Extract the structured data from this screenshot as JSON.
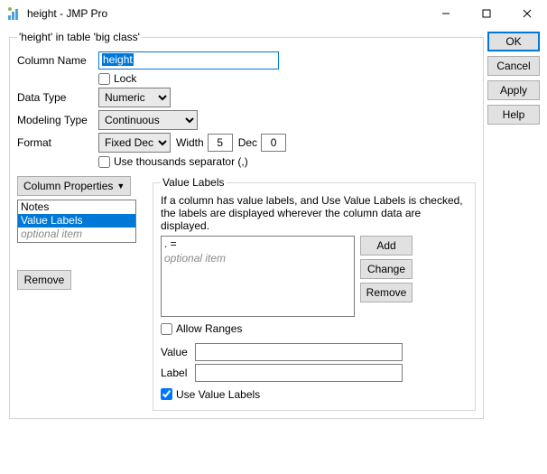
{
  "window": {
    "title": "height - JMP Pro"
  },
  "sideButtons": {
    "ok": "OK",
    "cancel": "Cancel",
    "apply": "Apply",
    "help": "Help"
  },
  "mainGroup": {
    "legend": "'height' in table 'big class'",
    "columnNameLabel": "Column Name",
    "columnNameValue": "height",
    "lockLabel": "Lock",
    "lockChecked": false,
    "dataTypeLabel": "Data Type",
    "dataTypeValue": "Numeric",
    "modelingTypeLabel": "Modeling Type",
    "modelingTypeValue": "Continuous",
    "formatLabel": "Format",
    "formatValue": "Fixed Dec",
    "widthLabel": "Width",
    "widthValue": "5",
    "decLabel": "Dec",
    "decValue": "0",
    "thousandsLabel": "Use thousands separator (,)",
    "thousandsChecked": false
  },
  "columnProps": {
    "buttonLabel": "Column Properties",
    "items": [
      "Notes",
      "Value Labels"
    ],
    "optional": "optional item",
    "selectedIndex": 1,
    "removeLabel": "Remove"
  },
  "valueLabels": {
    "legend": "Value Labels",
    "desc": "If a column has value labels, and Use Value Labels is checked, the labels are displayed wherever the column data are displayed.",
    "listItems": [
      ". ="
    ],
    "optional": "optional item",
    "addLabel": "Add",
    "changeLabel": "Change",
    "removeLabel": "Remove",
    "allowRangesLabel": "Allow Ranges",
    "allowRangesChecked": false,
    "valueFieldLabel": "Value",
    "valueFieldValue": "",
    "labelFieldLabel": "Label",
    "labelFieldValue": "",
    "useValueLabelsLabel": "Use Value Labels",
    "useValueLabelsChecked": true
  }
}
